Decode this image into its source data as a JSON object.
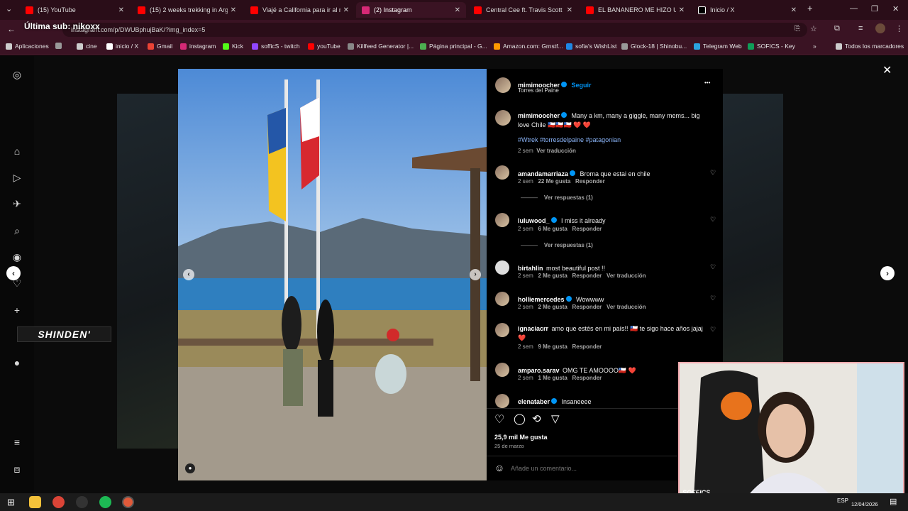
{
  "tabs": [
    {
      "label": "(15) YouTube",
      "color": "#ff0000"
    },
    {
      "label": "(15) 2 weeks trekking in Arg",
      "color": "#ff0000"
    },
    {
      "label": "Viajé a California para ir al mej",
      "color": "#ff0000"
    },
    {
      "label": "(2) Instagram",
      "color": "#d62976"
    },
    {
      "label": "Central Cee ft. Travis Scott - Mo",
      "color": "#ff0000"
    },
    {
      "label": "EL BANANERO ME HIZO UN A",
      "color": "#ff0000"
    },
    {
      "label": "Inicio / X",
      "color": "#ffffff"
    }
  ],
  "address": {
    "url": "instagram.com/p/DWUBphujBaK/?img_index=5",
    "overlay": "Última sub: nikoxx"
  },
  "bookmarks": [
    {
      "label": "Aplicaciones",
      "color": "#cccccc"
    },
    {
      "label": "cine",
      "color": "#cccccc"
    },
    {
      "label": "inicio / X",
      "color": "#ffffff"
    },
    {
      "label": "Gmail",
      "color": "#ea4335"
    },
    {
      "label": "instagram",
      "color": "#d62976"
    },
    {
      "label": "Kick",
      "color": "#53fc18"
    },
    {
      "label": "sofficS - twitch",
      "color": "#9146ff"
    },
    {
      "label": "youTube",
      "color": "#ff0000"
    },
    {
      "label": "Killfeed Generator |...",
      "color": "#888888"
    },
    {
      "label": "Página principal - G...",
      "color": "#4caf50"
    },
    {
      "label": "Amazon.com: Grnstf...",
      "color": "#ff9900"
    },
    {
      "label": "sofia's WishList",
      "color": "#1e88e5"
    },
    {
      "label": "Glock-18 | Shinobu...",
      "color": "#999999"
    },
    {
      "label": "Telegram Web",
      "color": "#2aa3df"
    },
    {
      "label": "SOFICS - Key",
      "color": "#0f9d58"
    },
    {
      "label": "Todos los marcadores",
      "color": "#cccccc"
    }
  ],
  "post": {
    "username": "mimimoocher",
    "follow": "Seguir",
    "location": "Torres del Paine",
    "caption": "Many a km, many a giggle, many mems... big love Chile ",
    "caption_tail": "🇨🇱🇨🇱🇨🇱 ❤️ ❤️",
    "hashtags": "#Wtrek #torresdelpaine #patagonian",
    "caption_meta": "2 sem",
    "see_translation": "Ver traducción",
    "likes": "25,9 mil Me gusta",
    "date": "25 de marzo",
    "add_comment": "Añade un comentario...",
    "more": "•••"
  },
  "comments": [
    {
      "user": "amandamarriaza",
      "verified": true,
      "text": "Broma que estai en chile",
      "time": "2 sem",
      "likes": "22 Me gusta",
      "reply": "Responder",
      "extra": "",
      "replies": "Ver respuestas (1)"
    },
    {
      "user": "luluwood_",
      "verified": true,
      "text": "I miss it already",
      "time": "2 sem",
      "likes": "6 Me gusta",
      "reply": "Responder",
      "extra": "",
      "replies": "Ver respuestas (1)"
    },
    {
      "user": "birtahlin",
      "verified": false,
      "text": "most beautiful post !!",
      "time": "2 sem",
      "likes": "2 Me gusta",
      "reply": "Responder",
      "extra": "Ver traducción",
      "replies": ""
    },
    {
      "user": "holliemercedes",
      "verified": true,
      "text": "Wowwww",
      "time": "2 sem",
      "likes": "2 Me gusta",
      "reply": "Responder",
      "extra": "Ver traducción",
      "replies": ""
    },
    {
      "user": "ignaciacrr",
      "verified": false,
      "text": "amo que estés en mi país!! 🇨🇱 te sigo hace años jajaj ❤️",
      "time": "2 sem",
      "likes": "9 Me gusta",
      "reply": "Responder",
      "extra": "",
      "replies": ""
    },
    {
      "user": "amparo.sarav",
      "verified": false,
      "text": "OMG TE AMOOOO🇨🇱 ❤️",
      "time": "2 sem",
      "likes": "1 Me gusta",
      "reply": "Responder",
      "extra": "",
      "replies": ""
    },
    {
      "user": "elenataber",
      "verified": true,
      "text": "Insaneeee",
      "time": "",
      "likes": "",
      "reply": "",
      "extra": "",
      "replies": ""
    }
  ],
  "overlay_brand": "SHINDEN'",
  "webcam_brand": "SOFFICS",
  "taskbar": {
    "lang": "ESP",
    "date": "12/04/2026"
  }
}
